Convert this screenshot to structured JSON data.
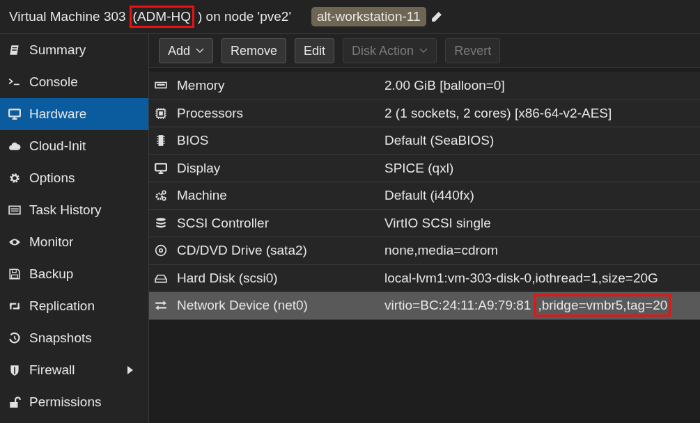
{
  "header": {
    "title_parts": [
      {
        "text": "Virtual Machine 303 ",
        "highlighted": false
      },
      {
        "text": "(ADM-HQ",
        "highlighted": true
      },
      {
        "text": ") on node 'pve2'",
        "highlighted": false
      }
    ],
    "tag": "alt-workstation-11"
  },
  "sidebar": {
    "items": [
      {
        "label": "Summary",
        "selected": false,
        "expandable": false
      },
      {
        "label": "Console",
        "selected": false,
        "expandable": false
      },
      {
        "label": "Hardware",
        "selected": true,
        "expandable": false
      },
      {
        "label": "Cloud-Init",
        "selected": false,
        "expandable": false
      },
      {
        "label": "Options",
        "selected": false,
        "expandable": false
      },
      {
        "label": "Task History",
        "selected": false,
        "expandable": false
      },
      {
        "label": "Monitor",
        "selected": false,
        "expandable": false
      },
      {
        "label": "Backup",
        "selected": false,
        "expandable": false
      },
      {
        "label": "Replication",
        "selected": false,
        "expandable": false
      },
      {
        "label": "Snapshots",
        "selected": false,
        "expandable": false
      },
      {
        "label": "Firewall",
        "selected": false,
        "expandable": true
      },
      {
        "label": "Permissions",
        "selected": false,
        "expandable": false
      }
    ]
  },
  "toolbar": {
    "buttons": [
      {
        "label": "Add",
        "disabled": false,
        "menu": true
      },
      {
        "label": "Remove",
        "disabled": false,
        "menu": false
      },
      {
        "label": "Edit",
        "disabled": false,
        "menu": false
      },
      {
        "label": "Disk Action",
        "disabled": true,
        "menu": true
      },
      {
        "label": "Revert",
        "disabled": true,
        "menu": false
      }
    ]
  },
  "table": {
    "rows": [
      {
        "name": "Memory",
        "selected": false,
        "value_parts": [
          {
            "text": "2.00 GiB [balloon=0]",
            "highlighted": false
          }
        ]
      },
      {
        "name": "Processors",
        "selected": false,
        "value_parts": [
          {
            "text": "2 (1 sockets, 2 cores) [x86-64-v2-AES]",
            "highlighted": false
          }
        ]
      },
      {
        "name": "BIOS",
        "selected": false,
        "value_parts": [
          {
            "text": "Default (SeaBIOS)",
            "highlighted": false
          }
        ]
      },
      {
        "name": "Display",
        "selected": false,
        "value_parts": [
          {
            "text": "SPICE (qxl)",
            "highlighted": false
          }
        ]
      },
      {
        "name": "Machine",
        "selected": false,
        "value_parts": [
          {
            "text": "Default (i440fx)",
            "highlighted": false
          }
        ]
      },
      {
        "name": "SCSI Controller",
        "selected": false,
        "value_parts": [
          {
            "text": "VirtIO SCSI single",
            "highlighted": false
          }
        ]
      },
      {
        "name": "CD/DVD Drive (sata2)",
        "selected": false,
        "value_parts": [
          {
            "text": "none,media=cdrom",
            "highlighted": false
          }
        ]
      },
      {
        "name": "Hard Disk (scsi0)",
        "selected": false,
        "value_parts": [
          {
            "text": "local-lvm1:vm-303-disk-0,iothread=1,size=20G",
            "highlighted": false
          }
        ]
      },
      {
        "name": "Network Device (net0)",
        "selected": true,
        "value_parts": [
          {
            "text": "virtio=BC:24:11:A9:79:81",
            "highlighted": false
          },
          {
            "text": ",bridge=vmbr5,tag=20",
            "highlighted": true
          }
        ]
      }
    ]
  }
}
